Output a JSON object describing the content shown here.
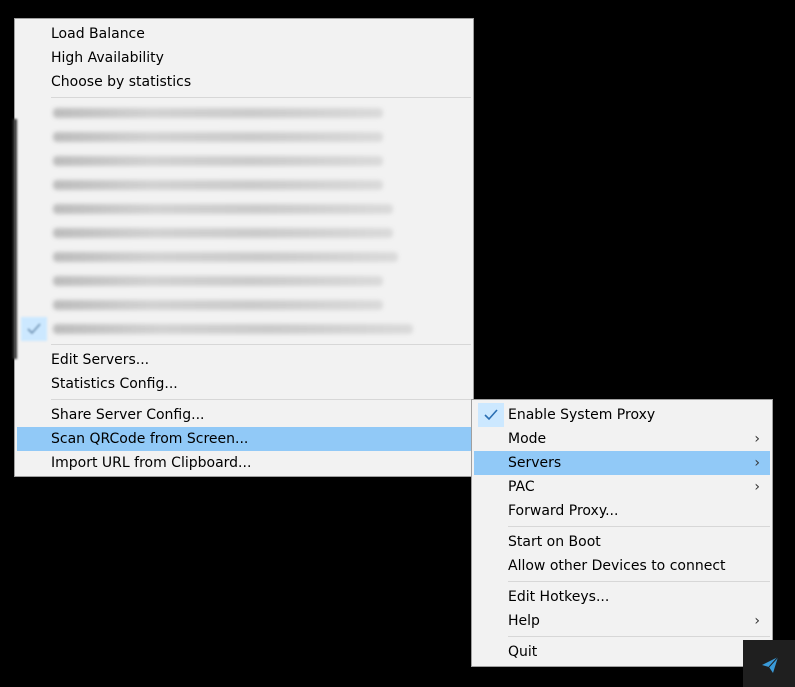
{
  "servers_menu": {
    "strategies": [
      "Load Balance",
      "High Availability",
      "Choose by statistics"
    ],
    "edit_servers": "Edit Servers...",
    "statistics_config": "Statistics Config...",
    "share_server_config": "Share Server Config...",
    "scan_qrcode": "Scan QRCode from Screen...",
    "import_url": "Import URL from Clipboard..."
  },
  "main_menu": {
    "enable_system_proxy": "Enable System Proxy",
    "mode": "Mode",
    "servers": "Servers",
    "pac": "PAC",
    "forward_proxy": "Forward Proxy...",
    "start_on_boot": "Start on Boot",
    "allow_other_devices": "Allow other Devices to connect",
    "edit_hotkeys": "Edit Hotkeys...",
    "help": "Help",
    "quit": "Quit"
  },
  "icons": {
    "submenu_arrow": "chevron-right-icon",
    "check": "checkmark-icon",
    "tray": "paper-plane-icon"
  },
  "colors": {
    "highlight": "#91c9f7",
    "menu_bg": "#f2f2f2",
    "check_bg": "#cce8ff"
  }
}
